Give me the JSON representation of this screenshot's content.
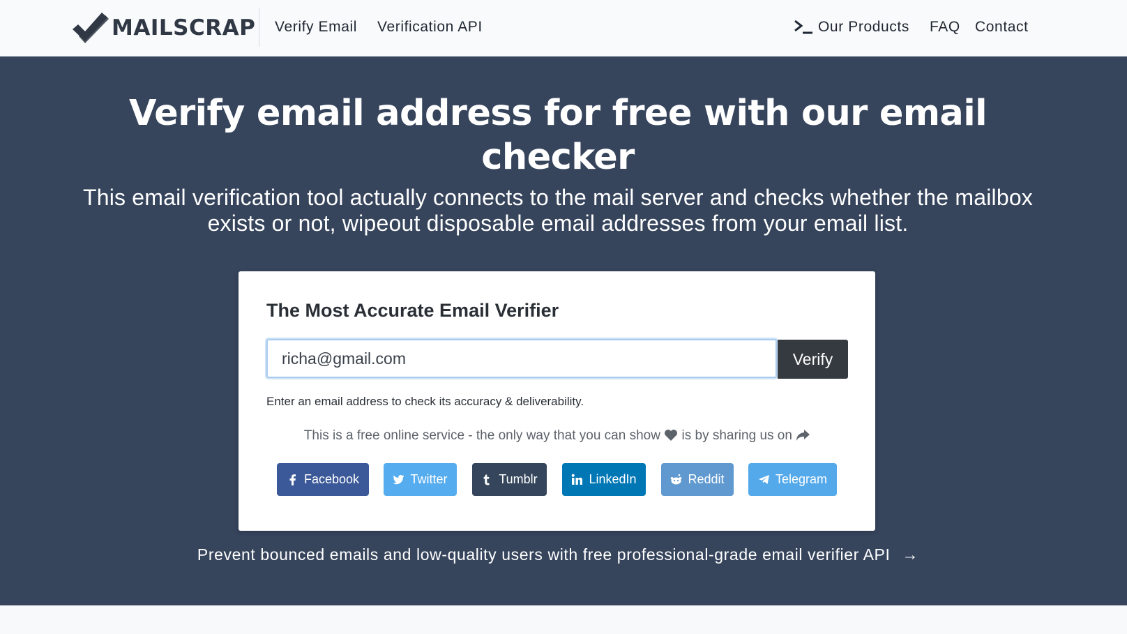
{
  "brand": {
    "name": "MAILSCRAP"
  },
  "nav": {
    "left": [
      "Verify Email",
      "Verification API"
    ],
    "products": "Our Products",
    "faq": "FAQ",
    "contact": "Contact"
  },
  "hero": {
    "title": "Verify email address for free with our email checker",
    "subtitle": "This email verification tool actually connects to the mail server and checks whether the mailbox exists or not, wipeout disposable email addresses from your email list."
  },
  "verifier": {
    "title": "The Most Accurate Email Verifier",
    "input_value": "richa@gmail.com",
    "button_label": "Verify",
    "help_text": "Enter an email address to check its accuracy & deliverability.",
    "share_prefix": "This is a free online service - the only way that you can show",
    "share_suffix": "is by sharing us on"
  },
  "share": [
    {
      "label": "Facebook",
      "icon": "facebook-icon",
      "color": "#3b5998"
    },
    {
      "label": "Twitter",
      "icon": "twitter-icon",
      "color": "#55acee"
    },
    {
      "label": "Tumblr",
      "icon": "tumblr-icon",
      "color": "#35465c"
    },
    {
      "label": "LinkedIn",
      "icon": "linkedin-icon",
      "color": "#0077b5"
    },
    {
      "label": "Reddit",
      "icon": "reddit-icon",
      "color": "#5f99cf"
    },
    {
      "label": "Telegram",
      "icon": "telegram-icon",
      "color": "#54a9eb"
    }
  ],
  "api_cta": "Prevent bounced emails and low-quality users with free professional-grade email verifier API",
  "api_arrow": "→",
  "colors": {
    "hero_bg": "#36445c",
    "nav_bg": "#f9fafb",
    "button_dark": "#343a40"
  }
}
